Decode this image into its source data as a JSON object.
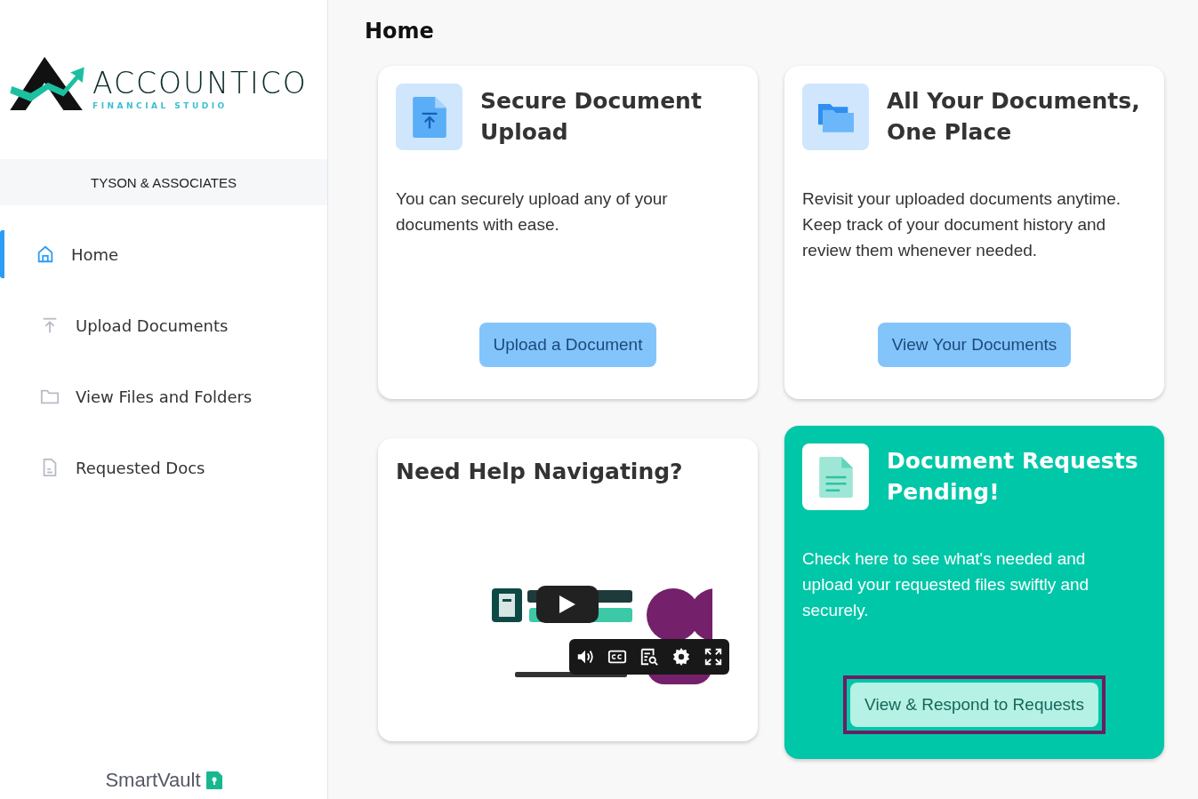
{
  "logo": {
    "name": "ACCOUNTICO",
    "tagline": "FINANCIAL STUDIO"
  },
  "firm": "TYSON & ASSOCIATES",
  "nav": [
    {
      "label": "Home",
      "selected": true
    },
    {
      "label": "Upload Documents",
      "selected": false
    },
    {
      "label": "View Files and Folders",
      "selected": false
    },
    {
      "label": "Requested Docs",
      "selected": false
    }
  ],
  "footer_brand": "SmartVault",
  "page_title": "Home",
  "cards": [
    {
      "kind": "standard",
      "title": "Secure Document Upload",
      "text": "You can securely upload any of your documents with ease.",
      "button": "Upload a Document"
    },
    {
      "kind": "standard",
      "title": "All Your Documents, One Place",
      "text": "Revisit your uploaded documents anytime. Keep track of your document history and review them whenever needed.",
      "button": "View Your Documents"
    },
    {
      "kind": "video",
      "title": "Need Help Navigating?"
    },
    {
      "kind": "highlight",
      "title": "Document Requests Pending!",
      "text": "Check here to see what's needed and upload your requested files swiftly and securely.",
      "button": "View & Respond to Requests",
      "focused": true
    }
  ]
}
